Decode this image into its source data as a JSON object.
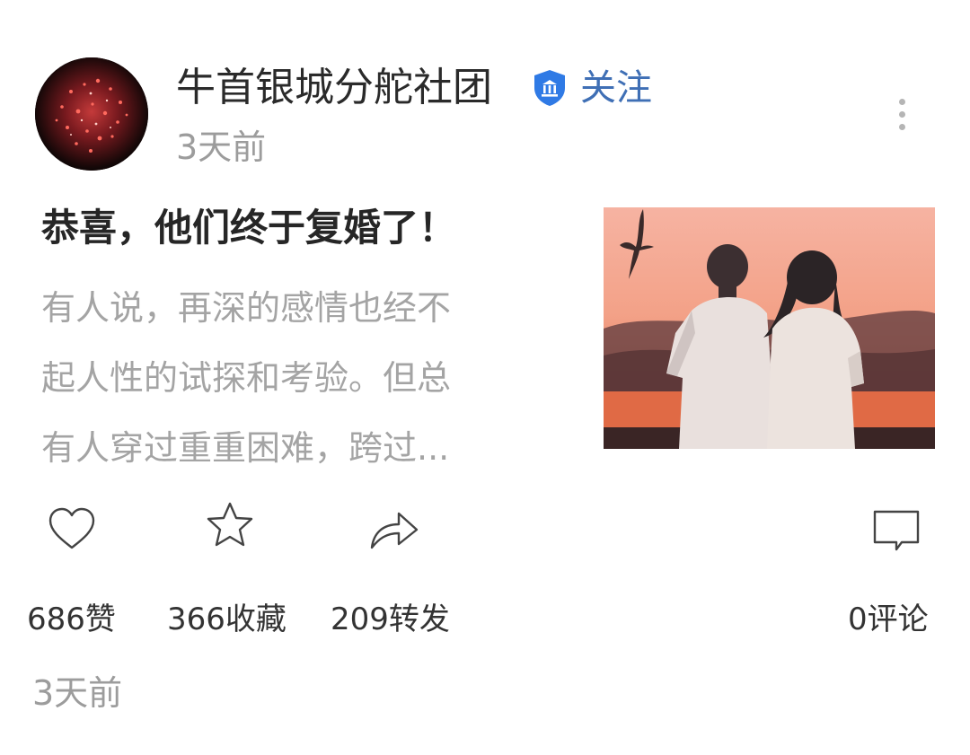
{
  "author": {
    "name": "牛首银城分舵社团",
    "avatar_icon": "avatar-fireworks",
    "verified_icon": "verified-institution-badge",
    "verified_color": "#2f7ae5",
    "follow_label": "关注",
    "follow_color": "#3f6fb5"
  },
  "post": {
    "time": "3天前",
    "title": "恭喜，他们终于复婚了！",
    "excerpt_lines": [
      "有人说，再深的感情也经不",
      "起人性的试探和考验。但总",
      "有人穿过重重困难，跨过..."
    ],
    "image_icon": "sunset-couple-photo"
  },
  "actions": {
    "like": {
      "icon": "heart-icon",
      "count_label": "686赞"
    },
    "favorite": {
      "icon": "star-icon",
      "count_label": "366收藏"
    },
    "share": {
      "icon": "share-arrow-icon",
      "count_label": "209转发"
    },
    "comment": {
      "icon": "comment-bubble-icon",
      "count_label": "0评论"
    }
  },
  "footer": {
    "time": "3天前"
  },
  "menu": {
    "icon": "more-vertical-icon"
  }
}
